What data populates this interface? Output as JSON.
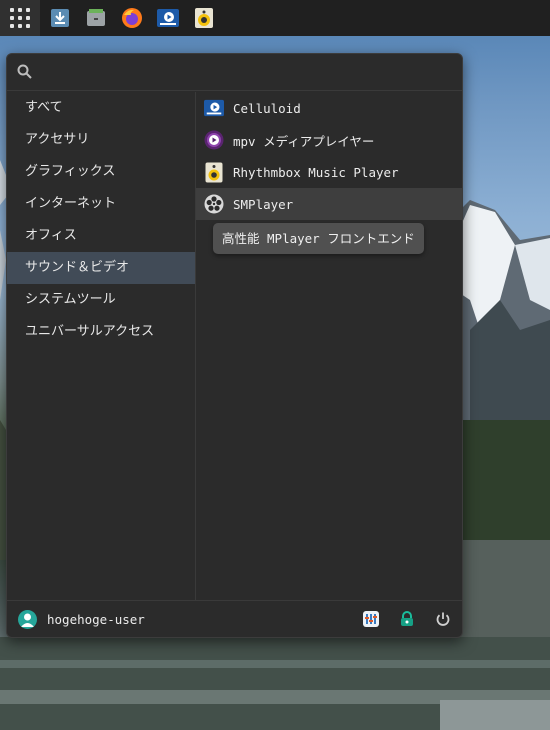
{
  "taskbar": {
    "launchers": [
      "app-grid-icon",
      "downloads-icon",
      "files-icon",
      "firefox-icon",
      "celluloid-icon",
      "rhythmbox-icon"
    ]
  },
  "search": {
    "placeholder": "",
    "value": ""
  },
  "categories": [
    {
      "label": "すべて",
      "active": false
    },
    {
      "label": "アクセサリ",
      "active": false
    },
    {
      "label": "グラフィックス",
      "active": false
    },
    {
      "label": "インターネット",
      "active": false
    },
    {
      "label": "オフィス",
      "active": false
    },
    {
      "label": "サウンド＆ビデオ",
      "active": true
    },
    {
      "label": "システムツール",
      "active": false
    },
    {
      "label": "ユニバーサルアクセス",
      "active": false
    }
  ],
  "apps": [
    {
      "label": "Celluloid",
      "icon": "celluloid-icon"
    },
    {
      "label": "mpv メディアプレイヤー",
      "icon": "mpv-icon"
    },
    {
      "label": "Rhythmbox Music Player",
      "icon": "rhythmbox-icon"
    },
    {
      "label": "SMPlayer",
      "icon": "smplayer-icon",
      "hovered": true
    }
  ],
  "tooltip": {
    "text": "高性能 MPlayer フロントエンド"
  },
  "user": {
    "name": "hogehoge-user"
  },
  "bottom_actions": [
    "settings-icon",
    "lock-icon",
    "power-icon"
  ],
  "colors": {
    "menu_bg": "#2b2b2b",
    "active_category": "#414b57",
    "hover_row": "#3e3e3e",
    "taskbar": "#202020",
    "avatar": "#26a69a"
  }
}
